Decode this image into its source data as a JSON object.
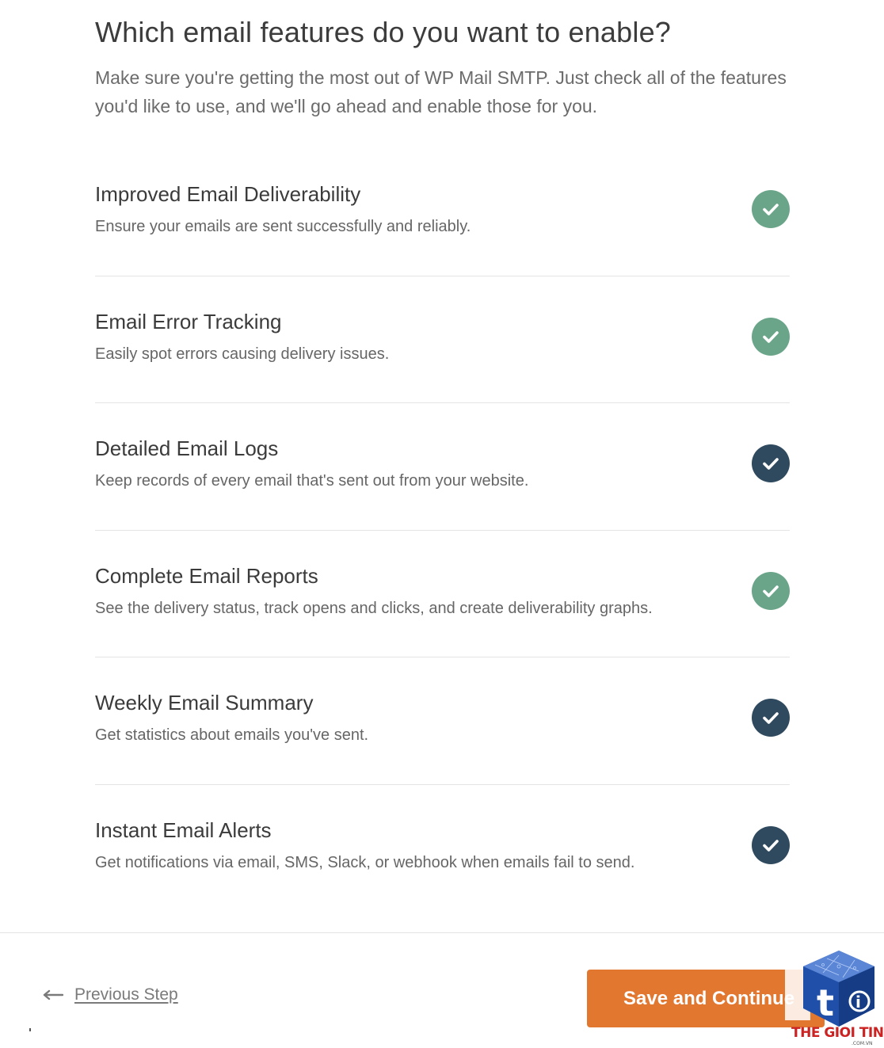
{
  "page": {
    "heading": "Which email features do you want to enable?",
    "intro": "Make sure you're getting the most out of WP Mail SMTP. Just check all of the features you'd like to use, and we'll go ahead and enable those for you."
  },
  "features": [
    {
      "title": "Improved Email Deliverability",
      "description": "Ensure your emails are sent successfully and reliably.",
      "checked": true,
      "check_style": "locked"
    },
    {
      "title": "Email Error Tracking",
      "description": "Easily spot errors causing delivery issues.",
      "checked": true,
      "check_style": "locked"
    },
    {
      "title": "Detailed Email Logs",
      "description": "Keep records of every email that's sent out from your website.",
      "checked": true,
      "check_style": "selected"
    },
    {
      "title": "Complete Email Reports",
      "description": "See the delivery status, track opens and clicks, and create deliverability graphs.",
      "checked": true,
      "check_style": "locked"
    },
    {
      "title": "Weekly Email Summary",
      "description": "Get statistics about emails you've sent.",
      "checked": true,
      "check_style": "selected"
    },
    {
      "title": "Instant Email Alerts",
      "description": "Get notifications via email, SMS, Slack, or webhook when emails fail to send.",
      "checked": true,
      "check_style": "selected"
    }
  ],
  "footer": {
    "previous_label": "Previous Step",
    "save_label": "Save and Continue"
  },
  "watermark": {
    "brand": "THE GIOI TINHOC",
    "domain": ".COM.VN"
  },
  "colors": {
    "check_locked": "#6aa589",
    "check_selected": "#2f4a5e",
    "save_button": "#e27730",
    "watermark_text": "#cc2222"
  },
  "icons": {
    "check": "check-icon",
    "previous": "arrow-left-icon",
    "logo": "thegioitinhoc-logo-icon"
  }
}
